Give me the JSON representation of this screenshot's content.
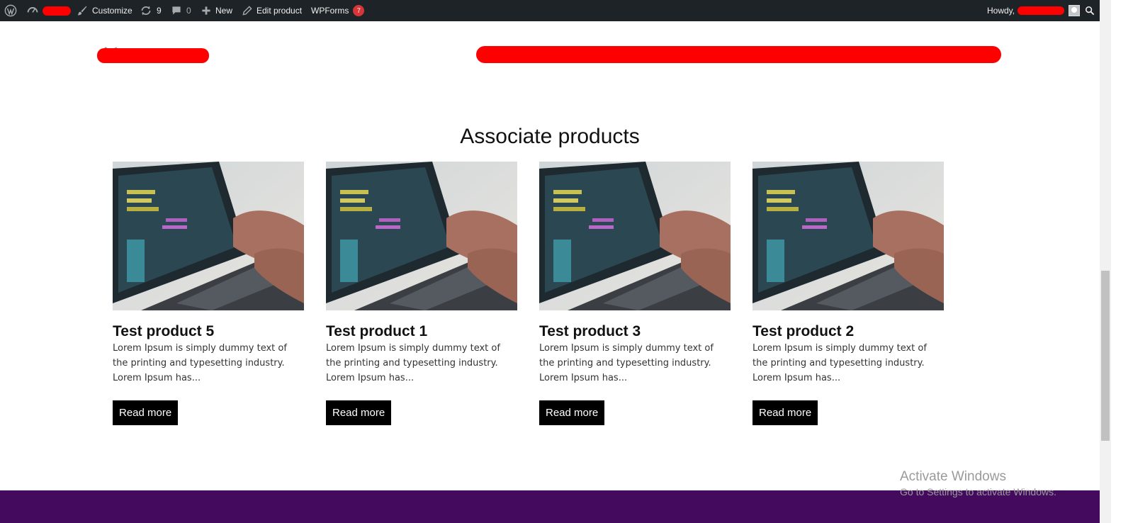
{
  "adminbar": {
    "customize_label": "Customize",
    "updates_count": "9",
    "comments_count": "0",
    "new_label": "New",
    "edit_label": "Edit product",
    "wpforms_label": "WPForms",
    "wpforms_badge": "7",
    "howdy_label": "Howdy,"
  },
  "section": {
    "title": "Associate products",
    "read_more_label": "Read more",
    "products": [
      {
        "title": "Test product 5",
        "excerpt": "Lorem Ipsum is simply dummy text of the printing and typesetting industry. Lorem Ipsum has..."
      },
      {
        "title": "Test product 1",
        "excerpt": "Lorem Ipsum is simply dummy text of the printing and typesetting industry. Lorem Ipsum has..."
      },
      {
        "title": "Test product 3",
        "excerpt": "Lorem Ipsum is simply dummy text of the printing and typesetting industry. Lorem Ipsum has..."
      },
      {
        "title": "Test product 2",
        "excerpt": "Lorem Ipsum is simply dummy text of the printing and typesetting industry. Lorem Ipsum has..."
      }
    ]
  },
  "watermark": {
    "line1": "Activate Windows",
    "line2": "Go to Settings to activate Windows."
  },
  "colors": {
    "adminbar_bg": "#1d2327",
    "footer_bg": "#440a5e",
    "button_bg": "#000000",
    "redaction": "#ff0000",
    "badge": "#d63638"
  },
  "icons": [
    "wordpress-icon",
    "dashboard-icon",
    "brush-icon",
    "updates-icon",
    "comment-icon",
    "plus-icon",
    "pencil-icon",
    "search-icon",
    "avatar"
  ]
}
